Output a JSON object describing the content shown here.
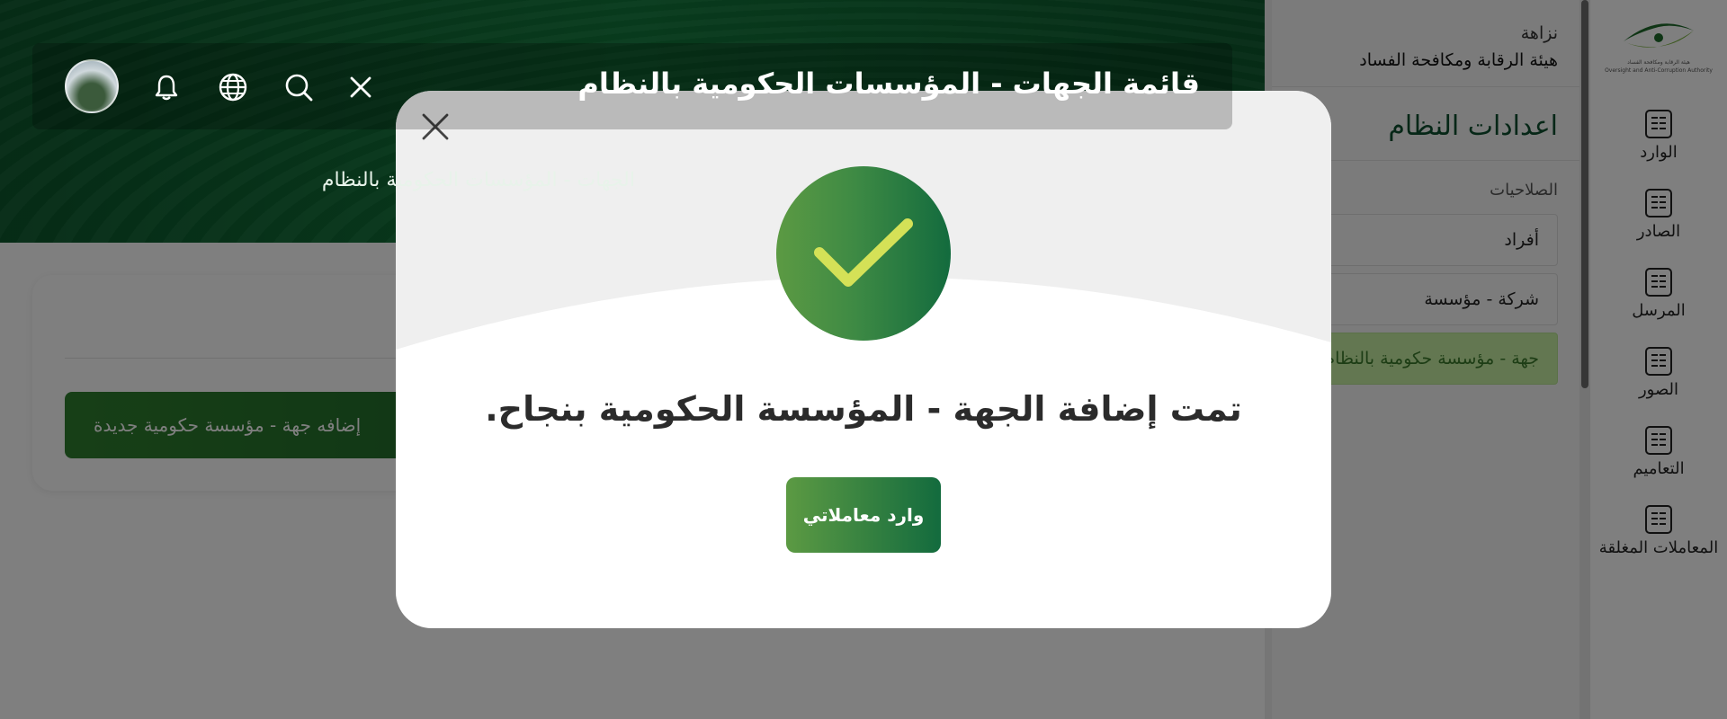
{
  "rail": {
    "logo_text": "نزاهة",
    "logo_subtitle": "هيئة الرقابة ومكافحة الفساد",
    "logo_english": "Oversight and Anti-Corruption Authority",
    "items": [
      {
        "label": "الوارد",
        "icon": "inbox-doc-icon"
      },
      {
        "label": "الصادر",
        "icon": "outbox-doc-icon"
      },
      {
        "label": "المرسل",
        "icon": "sent-doc-icon"
      },
      {
        "label": "الصور",
        "icon": "copies-doc-icon"
      },
      {
        "label": "التعاميم",
        "icon": "circulars-doc-icon"
      },
      {
        "label": "المعاملات المغلقة",
        "icon": "closed-doc-icon"
      }
    ]
  },
  "side_panel": {
    "org_short": "نزاهة",
    "org_full": "هيئة الرقابة ومكافحة الفساد",
    "title": "اعدادات النظام",
    "section": "الصلاحيات",
    "items": [
      {
        "label": "أفراد",
        "active": false
      },
      {
        "label": "شركة - مؤسسة",
        "active": false
      },
      {
        "label": "جهة - مؤسسة حكومية بالنظام",
        "active": true
      }
    ]
  },
  "topbar": {
    "title": "قائمة الجهات - المؤسسات الحكومية بالنظام",
    "icons": [
      "close-icon",
      "search-icon",
      "globe-icon",
      "bell-icon",
      "avatar"
    ]
  },
  "hero": {
    "subtitle": "الجهات - المؤسسات الحكومية بالنظام"
  },
  "card": {
    "add_button": "إضافه جهة - مؤسسة حكومية جديدة"
  },
  "modal": {
    "message": "تمت إضافة الجهة - المؤسسة الحكومية بنجاح.",
    "button": "وارد معاملاتي"
  },
  "colors": {
    "primary_green": "#136b3e",
    "light_green": "#5c9a43",
    "check_yellow": "#d4e157",
    "active_item_bg": "#c6eea3"
  }
}
